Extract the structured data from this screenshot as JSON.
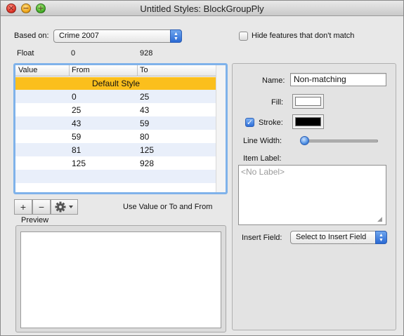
{
  "window": {
    "title": "Untitled Styles: BlockGroupPly"
  },
  "controls": {
    "close_symbol": "×",
    "minimize_symbol": "−",
    "zoom_symbol": "+"
  },
  "based_on": {
    "label": "Based on:",
    "value": "Crime 2007"
  },
  "hide_features": {
    "label": "Hide features that don't match",
    "checked": false
  },
  "range_info": {
    "type": "Float",
    "min": "0",
    "max": "928"
  },
  "table": {
    "columns": [
      "Value",
      "From",
      "To"
    ],
    "default_row": "Default Style",
    "rows": [
      {
        "from": "0",
        "to": "25"
      },
      {
        "from": "25",
        "to": "43"
      },
      {
        "from": "43",
        "to": "59"
      },
      {
        "from": "59",
        "to": "80"
      },
      {
        "from": "81",
        "to": "125"
      },
      {
        "from": "125",
        "to": "928"
      }
    ],
    "accent_color": "#fbbf1c",
    "selection_ring_color": "#7fb2ea"
  },
  "table_buttons": {
    "add": "+",
    "remove": "−",
    "action_icon": "gear-icon",
    "hint": "Use Value or To and From"
  },
  "preview": {
    "label": "Preview"
  },
  "style_panel": {
    "name_label": "Name:",
    "name_value": "Non-matching",
    "fill_label": "Fill:",
    "fill_color": "#ffffff",
    "stroke_label": "Stroke:",
    "stroke_checked": true,
    "stroke_color": "#000000",
    "line_width_label": "Line Width:",
    "line_width_fraction": 0.05,
    "item_label_label": "Item Label:",
    "item_label_placeholder": "<No Label>",
    "insert_field_label": "Insert Field:",
    "insert_field_value": "Select to Insert Field"
  }
}
